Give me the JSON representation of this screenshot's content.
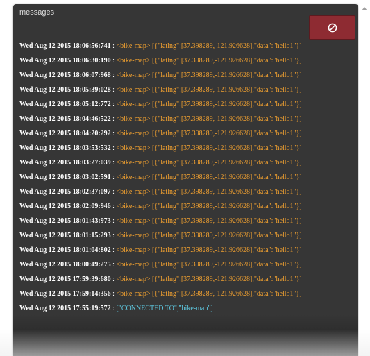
{
  "panel": {
    "title": "messages",
    "clear_icon": "no-entry-icon"
  },
  "messages": [
    {
      "timestamp": "Wed Aug 12 2015 18:06:56:741",
      "sep": " : ",
      "channel": "<bike-map>",
      "payload": " [{\"latlng\":[37.398289,-121.926628],\"data\":\"hello1\"}]"
    },
    {
      "timestamp": "Wed Aug 12 2015 18:06:30:190",
      "sep": " : ",
      "channel": "<bike-map>",
      "payload": " [{\"latlng\":[37.398289,-121.926628],\"data\":\"hello1\"}]"
    },
    {
      "timestamp": "Wed Aug 12 2015 18:06:07:968",
      "sep": " : ",
      "channel": "<bike-map>",
      "payload": " [{\"latlng\":[37.398289,-121.926628],\"data\":\"hello1\"}]"
    },
    {
      "timestamp": "Wed Aug 12 2015 18:05:39:028",
      "sep": " : ",
      "channel": "<bike-map>",
      "payload": " [{\"latlng\":[37.398289,-121.926628],\"data\":\"hello1\"}]"
    },
    {
      "timestamp": "Wed Aug 12 2015 18:05:12:772",
      "sep": " : ",
      "channel": "<bike-map>",
      "payload": " [{\"latlng\":[37.398289,-121.926628],\"data\":\"hello1\"}]"
    },
    {
      "timestamp": "Wed Aug 12 2015 18:04:46:522",
      "sep": " : ",
      "channel": "<bike-map>",
      "payload": " [{\"latlng\":[37.398289,-121.926628],\"data\":\"hello1\"}]"
    },
    {
      "timestamp": "Wed Aug 12 2015 18:04:20:292",
      "sep": " : ",
      "channel": "<bike-map>",
      "payload": " [{\"latlng\":[37.398289,-121.926628],\"data\":\"hello1\"}]"
    },
    {
      "timestamp": "Wed Aug 12 2015 18:03:53:532",
      "sep": " : ",
      "channel": "<bike-map>",
      "payload": " [{\"latlng\":[37.398289,-121.926628],\"data\":\"hello1\"}]"
    },
    {
      "timestamp": "Wed Aug 12 2015 18:03:27:039",
      "sep": " : ",
      "channel": "<bike-map>",
      "payload": " [{\"latlng\":[37.398289,-121.926628],\"data\":\"hello1\"}]"
    },
    {
      "timestamp": "Wed Aug 12 2015 18:03:02:591",
      "sep": " : ",
      "channel": "<bike-map>",
      "payload": " [{\"latlng\":[37.398289,-121.926628],\"data\":\"hello1\"}]"
    },
    {
      "timestamp": "Wed Aug 12 2015 18:02:37:097",
      "sep": " : ",
      "channel": "<bike-map>",
      "payload": " [{\"latlng\":[37.398289,-121.926628],\"data\":\"hello1\"}]"
    },
    {
      "timestamp": "Wed Aug 12 2015 18:02:09:946",
      "sep": " : ",
      "channel": "<bike-map>",
      "payload": " [{\"latlng\":[37.398289,-121.926628],\"data\":\"hello1\"}]"
    },
    {
      "timestamp": "Wed Aug 12 2015 18:01:43:973",
      "sep": " : ",
      "channel": "<bike-map>",
      "payload": " [{\"latlng\":[37.398289,-121.926628],\"data\":\"hello1\"}]"
    },
    {
      "timestamp": "Wed Aug 12 2015 18:01:15:293",
      "sep": " : ",
      "channel": "<bike-map>",
      "payload": " [{\"latlng\":[37.398289,-121.926628],\"data\":\"hello1\"}]"
    },
    {
      "timestamp": "Wed Aug 12 2015 18:01:04:802",
      "sep": " : ",
      "channel": "<bike-map>",
      "payload": " [{\"latlng\":[37.398289,-121.926628],\"data\":\"hello1\"}]"
    },
    {
      "timestamp": "Wed Aug 12 2015 18:00:49:275",
      "sep": " : ",
      "channel": "<bike-map>",
      "payload": " [{\"latlng\":[37.398289,-121.926628],\"data\":\"hello1\"}]"
    },
    {
      "timestamp": "Wed Aug 12 2015 17:59:39:680",
      "sep": " : ",
      "channel": "<bike-map>",
      "payload": " [{\"latlng\":[37.398289,-121.926628],\"data\":\"hello1\"}]"
    },
    {
      "timestamp": "Wed Aug 12 2015 17:59:14:356",
      "sep": " : ",
      "channel": "<bike-map>",
      "payload": " [{\"latlng\":[37.398289,-121.926628],\"data\":\"hello1\"}]"
    }
  ],
  "connected_message": {
    "timestamp": "Wed Aug 12 2015 17:55:19:572",
    "sep": " : ",
    "payload": "[\"CONNECTED TO\",\"bike-map\"]"
  },
  "colors": {
    "panel_bg": "#363636",
    "clear_button": "#8e2b32",
    "timestamp": "#ffffff",
    "channel": "#f0a030",
    "payload": "#f0a030",
    "system_payload": "#5ec8e0"
  }
}
